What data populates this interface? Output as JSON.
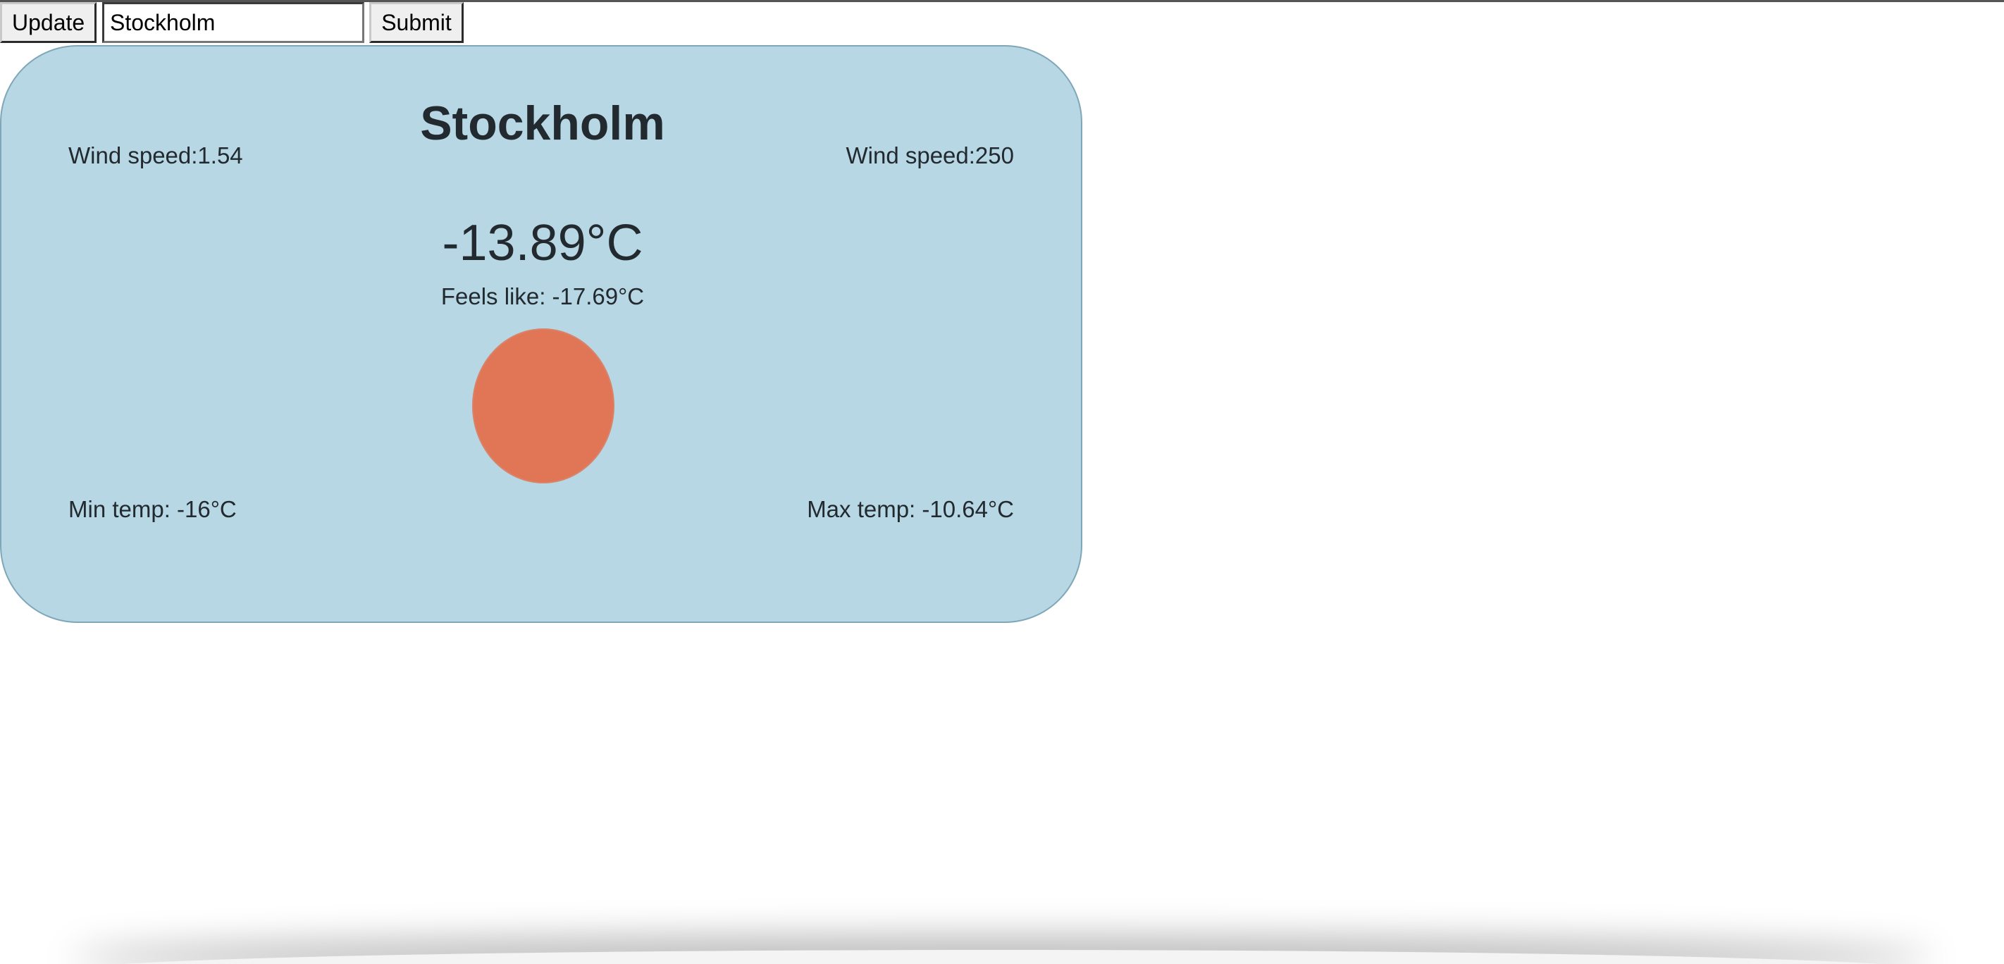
{
  "controls": {
    "update_label": "Update",
    "city_value": "Stockholm",
    "submit_label": "Submit"
  },
  "weather": {
    "city": "Stockholm",
    "wind_speed_left": "Wind speed:1.54",
    "wind_speed_right": "Wind speed:250",
    "temperature": "-13.89°C",
    "feels_like": "Feels like: -17.69°C",
    "min_temp": "Min temp: -16°C",
    "max_temp": "Max temp: -10.64°C",
    "icon": "sun-icon"
  },
  "colors": {
    "card_background": "#b6d7e3",
    "sun": "#e07655"
  }
}
